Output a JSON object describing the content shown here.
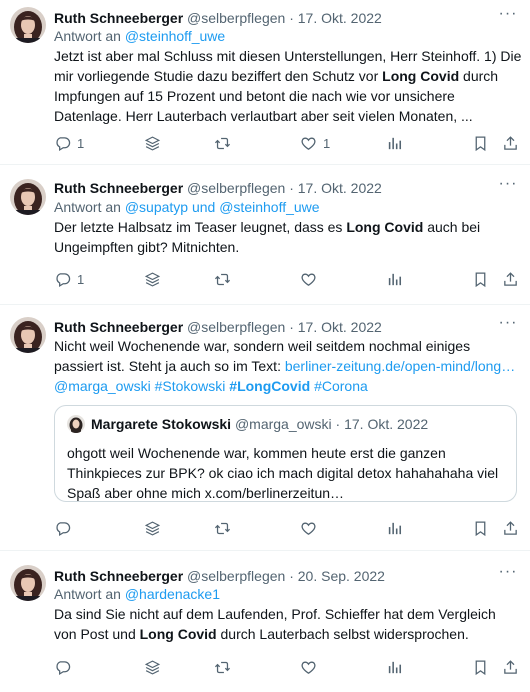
{
  "tweets": [
    {
      "author": "Ruth Schneeberger",
      "handle": "@selberpflegen",
      "sep": "·",
      "date": "17. Okt. 2022",
      "reply_prefix": "Antwort an",
      "reply_to": "@steinhoff_uwe",
      "text_parts": [
        "Jetzt ist aber mal Schluss mit diesen Unterstellungen, Herr Steinhoff. 1) Die mir vorliegende Studie dazu beziffert den Schutz vor ",
        "Long Covid",
        " durch Impfungen auf 15 Prozent und betont die nach wie vor unsichere Datenlage. Herr Lauterbach verlautbart aber seit vielen Monaten, ..."
      ],
      "reply_count": "1",
      "like_count": "1"
    },
    {
      "author": "Ruth Schneeberger",
      "handle": "@selberpflegen",
      "sep": "·",
      "date": "17. Okt. 2022",
      "reply_prefix": "Antwort an",
      "reply_to": "@supatyp und @steinhoff_uwe",
      "text_parts": [
        "Der letzte Halbsatz im Teaser leugnet, dass es ",
        "Long Covid",
        " auch bei Ungeimpften gibt? Mitnichten."
      ],
      "reply_count": "1",
      "like_count": ""
    },
    {
      "author": "Ruth Schneeberger",
      "handle": "@selberpflegen",
      "sep": "·",
      "date": "17. Okt. 2022",
      "text_plain": "Nicht weil Wochenende war, sondern weil seitdem nochmal einiges passiert ist. Steht ja auch so im Text: ",
      "link_url": "berliner-zeitung.de/open-mind/long…",
      "mention": "@marga_owski",
      "tag1": "#Stokowski",
      "tag2": "#LongCovid",
      "tag3": "#Corona",
      "quote": {
        "author": "Margarete Stokowski",
        "handle": "@marga_owski",
        "sep": "·",
        "date": "17. Okt. 2022",
        "text": "ohgott weil Wochenende war, kommen heute erst die ganzen Thinkpieces zur BPK? ok ciao ich mach digital detox hahahahaha viel Spaß aber ohne mich x.com/berlinerzeitun…"
      }
    },
    {
      "author": "Ruth Schneeberger",
      "handle": "@selberpflegen",
      "sep": "·",
      "date": "20. Sep. 2022",
      "reply_prefix": "Antwort an",
      "reply_to": "@hardenacke1",
      "text_parts": [
        "Da sind Sie nicht auf dem Laufenden, Prof. Schieffer hat dem Vergleich von Post und ",
        "Long Covid",
        " durch Lauterbach selbst widersprochen."
      ]
    }
  ],
  "icons": {
    "more": "more-icon",
    "reply": "reply-icon",
    "views": "layers-icon",
    "retweet": "retweet-icon",
    "like": "heart-icon",
    "stats": "analytics-icon",
    "bookmark": "bookmark-icon",
    "share": "share-icon"
  },
  "colors": {
    "link": "#1d9bf0",
    "muted": "#536471",
    "text": "#0f1419",
    "divider": "#eff3f4"
  }
}
